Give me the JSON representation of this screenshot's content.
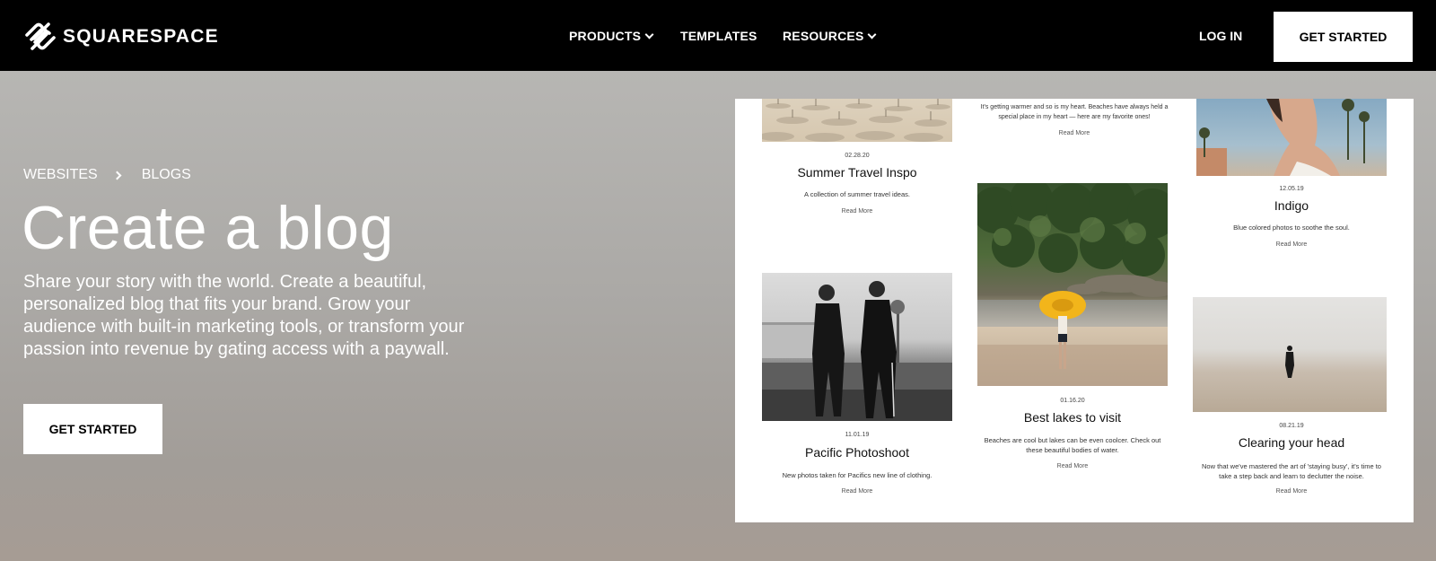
{
  "nav": {
    "brand": "SQUARESPACE",
    "items": [
      {
        "label": "PRODUCTS",
        "has_dropdown": true
      },
      {
        "label": "TEMPLATES",
        "has_dropdown": false
      },
      {
        "label": "RESOURCES",
        "has_dropdown": true
      }
    ],
    "login_label": "LOG IN",
    "cta_label": "GET STARTED"
  },
  "hero": {
    "breadcrumb": [
      "WEBSITES",
      "BLOGS"
    ],
    "title": "Create a blog",
    "description": "Share your story with the world. Create a beautiful, personalized blog that fits your brand. Grow your audience with built-in marketing tools, or transform your passion into revenue by gating access with a paywall.",
    "cta_label": "GET STARTED"
  },
  "blog_preview": {
    "top_snippet": "It's getting warmer and so is my heart. Beaches have always held a special place in my heart — here are my favorite ones!",
    "top_read_more": "Read More",
    "posts": [
      {
        "date": "02.28.20",
        "title": "Summer Travel Inspo",
        "desc": "A collection of summer travel ideas.",
        "read_more": "Read More"
      },
      {
        "date": "12.05.19",
        "title": "Indigo",
        "desc": "Blue colored photos to soothe the soul.",
        "read_more": "Read More"
      },
      {
        "date": "11.01.19",
        "title": "Pacific Photoshoot",
        "desc": "New photos taken for Pacifics new line of clothing.",
        "read_more": "Read More"
      },
      {
        "date": "01.16.20",
        "title": "Best lakes to visit",
        "desc": "Beaches are cool but lakes can be even coolcer. Check out these beautiful bodies of water.",
        "read_more": "Read More"
      },
      {
        "date": "08.21.19",
        "title": "Clearing your head",
        "desc": "Now that we've mastered the art of 'staying busy', it's time to take a step back and learn to declutter the noise.",
        "read_more": "Read More"
      }
    ]
  },
  "colors": {
    "nav_bg": "#000000",
    "hero_bg": "#aba9a6",
    "button_bg": "#ffffff"
  }
}
